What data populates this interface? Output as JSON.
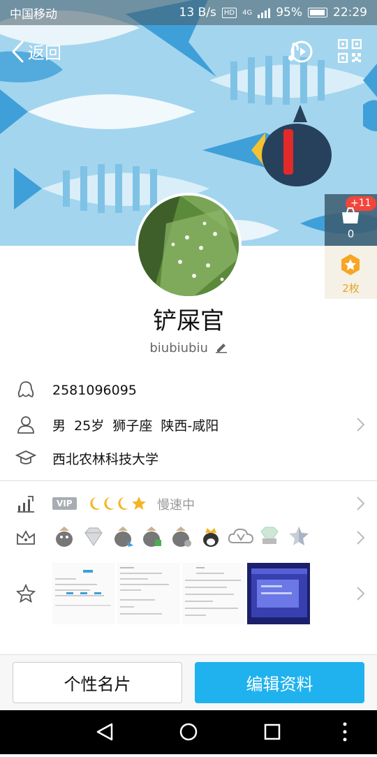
{
  "status_bar": {
    "carrier": "中国移动",
    "speed": "13 B/s",
    "hd": "HD",
    "network": "4G",
    "battery": "95%",
    "time": "22:29"
  },
  "topbar": {
    "back_label": "返回"
  },
  "side": {
    "like_badge": "+11",
    "like_count": "0",
    "gift_count": "2枚"
  },
  "profile": {
    "nickname": "铲屎官",
    "signature": "biubiubiu",
    "qq_number": "2581096095",
    "personal": "男  25岁  狮子座  陕西-咸阳",
    "school": "西北农林科技大学"
  },
  "level": {
    "vip_label": "VIP",
    "status": "慢速中"
  },
  "buttons": {
    "card": "个性名片",
    "edit": "编辑资料"
  },
  "colors": {
    "accent": "#1fb2ee",
    "badge_red": "#f0463c",
    "gold": "#e8a425"
  }
}
